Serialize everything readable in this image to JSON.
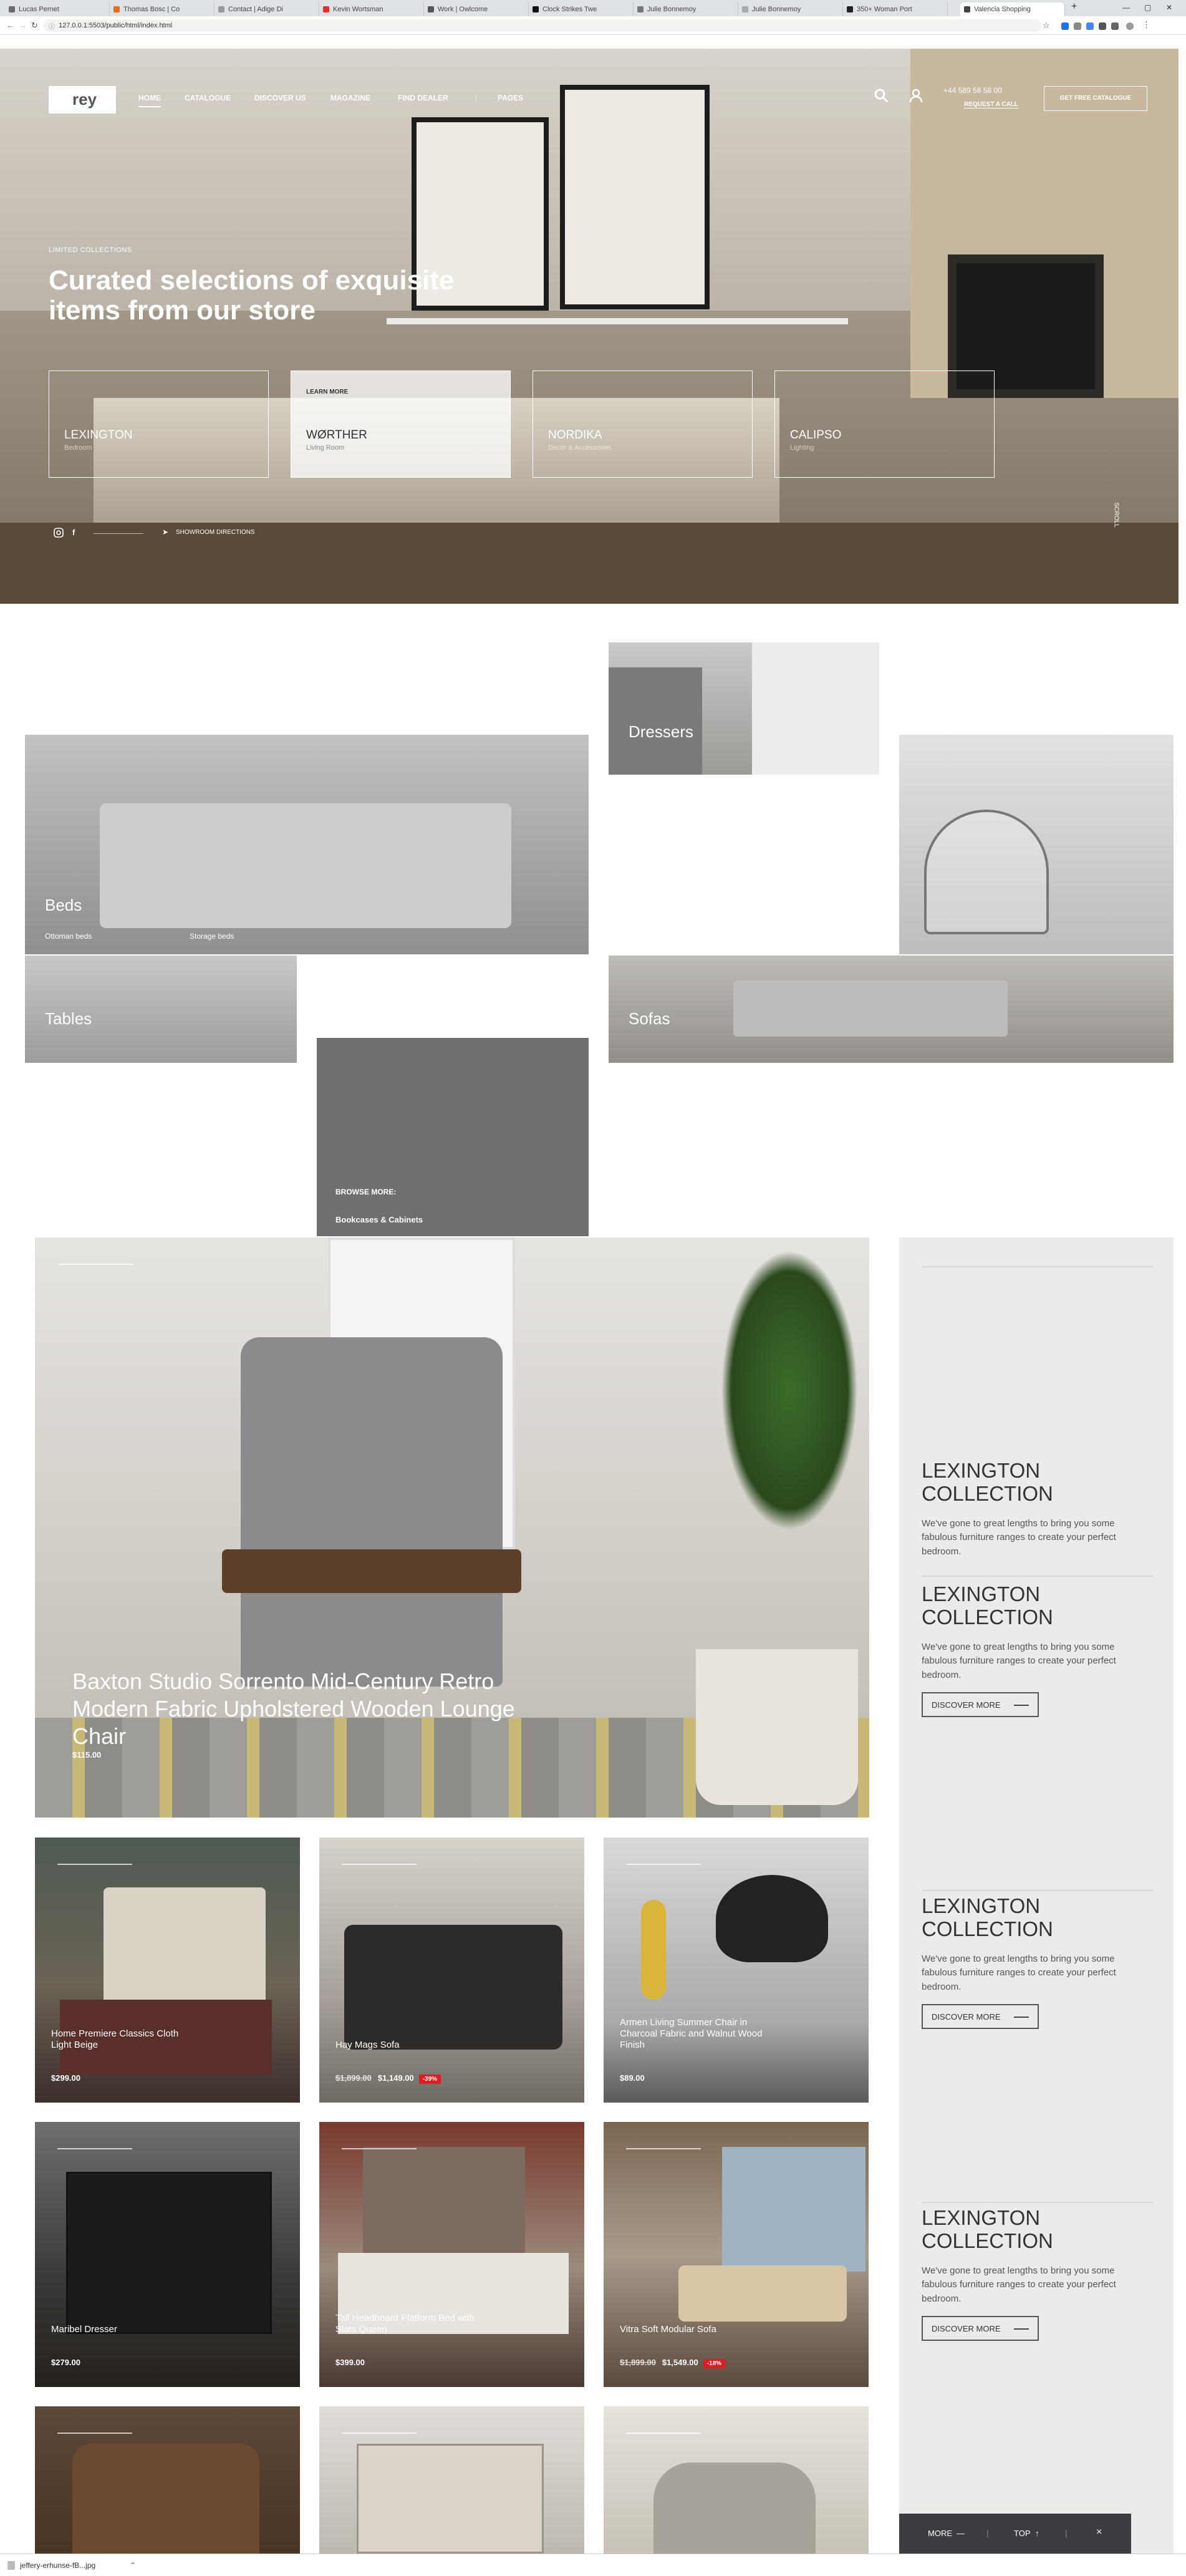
{
  "browser": {
    "tabs": [
      "Lucas Pernet",
      "Thomas Bosc | Co",
      "Contact | Adige Di",
      "Kevin Wortsman",
      "Work | Owlcome",
      "Clock Strikes Twe",
      "Julie Bonnemoy",
      "Julie Bonnemoy",
      "350+ Woman Port",
      "Valencia Shopping"
    ],
    "new_tab": "+",
    "url": "127.0.0.1:5503/public/html/index.html"
  },
  "header": {
    "logo": "rey",
    "nav": [
      "HOME",
      "CATALOGUE",
      "DISCOVER US",
      "MAGAZINE",
      "FIND DEALER",
      "PAGES"
    ],
    "phone": "+44 589 58 58 00",
    "request_call": "REQUEST A CALL",
    "catalogue_button": "GET FREE CATALOGUE"
  },
  "hero": {
    "kicker": "LIMITED COLLECTIONS",
    "title": "Curated selections of exquisite items from our store",
    "collections": [
      {
        "name": "LEXINGTON",
        "sub": "Bedroom"
      },
      {
        "name": "WØRTHER",
        "sub": "Living Room",
        "learn": "LEARN MORE"
      },
      {
        "name": "NORDIKA",
        "sub": "Decor & Accessories"
      },
      {
        "name": "CALIPSO",
        "sub": "Lighting"
      }
    ],
    "showroom": "SHOWROOM DIRECTIONS",
    "scroll": "SCROLL"
  },
  "categories": {
    "dressers": "Dressers",
    "beds": "Beds",
    "beds_links": [
      "Ottoman beds",
      "Storage beds"
    ],
    "tables": "Tables",
    "sofas": "Sofas",
    "browse_more": "BROWSE MORE:",
    "browse_link": "Bookcases & Cabinets"
  },
  "featured": {
    "title": "Baxton Studio Sorrento Mid-Century Retro Modern Fabric Upholstered Wooden Lounge Chair",
    "price": "$115.00"
  },
  "sidebar": {
    "blocks": [
      {
        "heading": "LEXINGTON COLLECTION",
        "text": "We've gone to great lengths to bring you some fabulous furniture ranges to create your perfect bedroom."
      },
      {
        "heading": "LEXINGTON COLLECTION",
        "text": "We've gone to great lengths to bring you some fabulous furniture ranges to create your perfect bedroom.",
        "button": "DISCOVER MORE"
      },
      {
        "heading": "LEXINGTON COLLECTION",
        "text": "We've gone to great lengths to bring you some fabulous furniture ranges to create your perfect bedroom.",
        "button": "DISCOVER MORE"
      },
      {
        "heading": "LEXINGTON COLLECTION",
        "text": "We've gone to great lengths to bring you some fabulous furniture ranges to create your perfect bedroom.",
        "button": "DISCOVER MORE"
      }
    ]
  },
  "products": [
    {
      "name": "Home Premiere Classics Cloth Light Beige",
      "price": "$299.00"
    },
    {
      "name": "Hay Mags Sofa",
      "old": "$1,899.00",
      "price": "$1,149.00",
      "sale": "-39%"
    },
    {
      "name": "Armen Living Summer Chair in Charcoal Fabric and Walnut Wood Finish",
      "price": "$89.00"
    },
    {
      "name": "Maribel Dresser",
      "price": "$279.00"
    },
    {
      "name": "Tall Headboard Platform Bed with Slats Queen",
      "price": "$399.00"
    },
    {
      "name": "Vitra Soft Modular Sofa",
      "old": "$1,899.00",
      "price": "$1,549.00",
      "sale": "-18%"
    }
  ],
  "bottom_bar": {
    "more": "MORE",
    "top": "TOP",
    "close": "×"
  },
  "download": {
    "file": "jeffery-erhunse-fB...jpg"
  },
  "colors": {
    "sale": "#e01b22",
    "side_bg": "#ebebeb",
    "grey_tile": "#6e6f70"
  }
}
